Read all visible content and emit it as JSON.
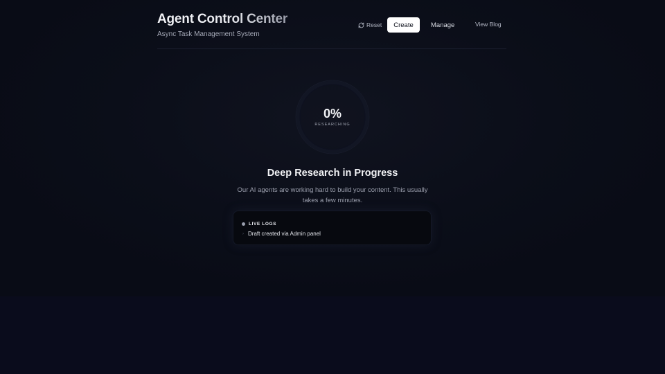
{
  "header": {
    "title": "Agent Control Center",
    "subtitle": "Async Task Management System",
    "nav": {
      "reset_label": "Reset",
      "create_label": "Create",
      "manage_label": "Manage",
      "blog_label": "View Blog"
    }
  },
  "progress": {
    "percent_text": "0%",
    "value": 0,
    "status": "RESEARCHING"
  },
  "main": {
    "headline": "Deep Research in Progress",
    "description": "Our AI agents are working hard to build your content. This usually takes a few minutes."
  },
  "logs": {
    "title": "LIVE LOGS",
    "entries": [
      {
        "text": "Draft created via Admin panel"
      }
    ]
  },
  "colors": {
    "background": "#0a0d18",
    "primary_button": "#ffffff",
    "text_primary": "#f2f3f6",
    "text_muted": "#9a9eac"
  },
  "icons": {
    "reset": "refresh-icon",
    "live": "live-dot-icon",
    "log_item": "chevron-right-icon"
  }
}
